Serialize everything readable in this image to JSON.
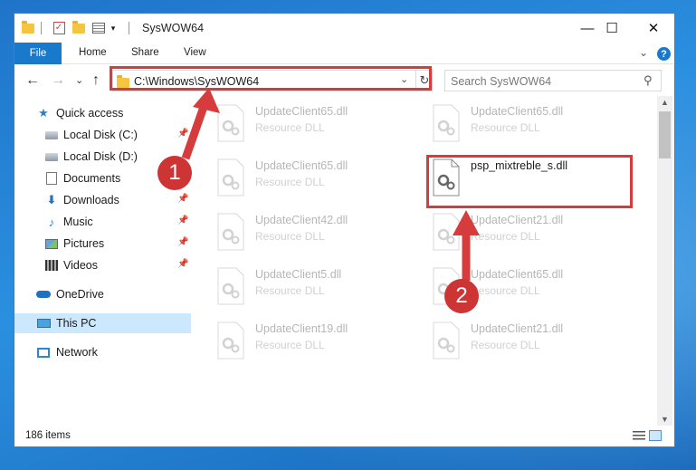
{
  "window": {
    "title": "SysWOW64",
    "minimize": "—",
    "maximize": "☐",
    "close": "✕"
  },
  "ribbon": {
    "tabs": [
      "File",
      "Home",
      "Share",
      "View"
    ],
    "expand": "⌄",
    "help": "?"
  },
  "navigation": {
    "back": "←",
    "forward": "→",
    "recent": "⌄",
    "up": "↑"
  },
  "address": {
    "path": "C:\\Windows\\SysWOW64",
    "dropdown": "⌄",
    "refresh": "↻"
  },
  "search": {
    "placeholder": "Search SysWOW64",
    "icon": "⚲"
  },
  "sidebar": {
    "items": [
      {
        "label": "Quick access",
        "icon": "star-icon",
        "pinned": false
      },
      {
        "label": "Local Disk (C:)",
        "icon": "drive-icon",
        "pinned": true
      },
      {
        "label": "Local Disk (D:)",
        "icon": "drive-icon",
        "pinned": false
      },
      {
        "label": "Documents",
        "icon": "documents-icon",
        "pinned": true
      },
      {
        "label": "Downloads",
        "icon": "download-icon",
        "pinned": true
      },
      {
        "label": "Music",
        "icon": "music-icon",
        "pinned": true
      },
      {
        "label": "Pictures",
        "icon": "pictures-icon",
        "pinned": true
      },
      {
        "label": "Videos",
        "icon": "videos-icon",
        "pinned": true
      },
      {
        "label": "OneDrive",
        "icon": "cloud-icon",
        "pinned": false
      },
      {
        "label": "This PC",
        "icon": "computer-icon",
        "pinned": false
      },
      {
        "label": "Network",
        "icon": "network-icon",
        "pinned": false
      }
    ],
    "pin_glyph": "📌"
  },
  "files": [
    {
      "name": "UpdateClient65.dll",
      "type": "Resource DLL",
      "highlighted": false
    },
    {
      "name": "UpdateClient65.dll",
      "type": "Resource DLL",
      "highlighted": false
    },
    {
      "name": "UpdateClient65.dll",
      "type": "Resource DLL",
      "highlighted": false
    },
    {
      "name": "psp_mixtreble_s.dll",
      "type": "",
      "highlighted": true
    },
    {
      "name": "UpdateClient42.dll",
      "type": "Resource DLL",
      "highlighted": false
    },
    {
      "name": "UpdateClient21.dll",
      "type": "Resource DLL",
      "highlighted": false
    },
    {
      "name": "UpdateClient5.dll",
      "type": "Resource DLL",
      "highlighted": false
    },
    {
      "name": "UpdateClient65.dll",
      "type": "Resource DLL",
      "highlighted": false
    },
    {
      "name": "UpdateClient19.dll",
      "type": "Resource DLL",
      "highlighted": false
    },
    {
      "name": "UpdateClient21.dll",
      "type": "Resource DLL",
      "highlighted": false
    }
  ],
  "status": {
    "item_count": "186 items"
  },
  "annotations": {
    "step1": "1",
    "step2": "2",
    "color": "#d63c3c"
  },
  "colors": {
    "accent": "#1979ca",
    "selection": "#cce8ff"
  }
}
